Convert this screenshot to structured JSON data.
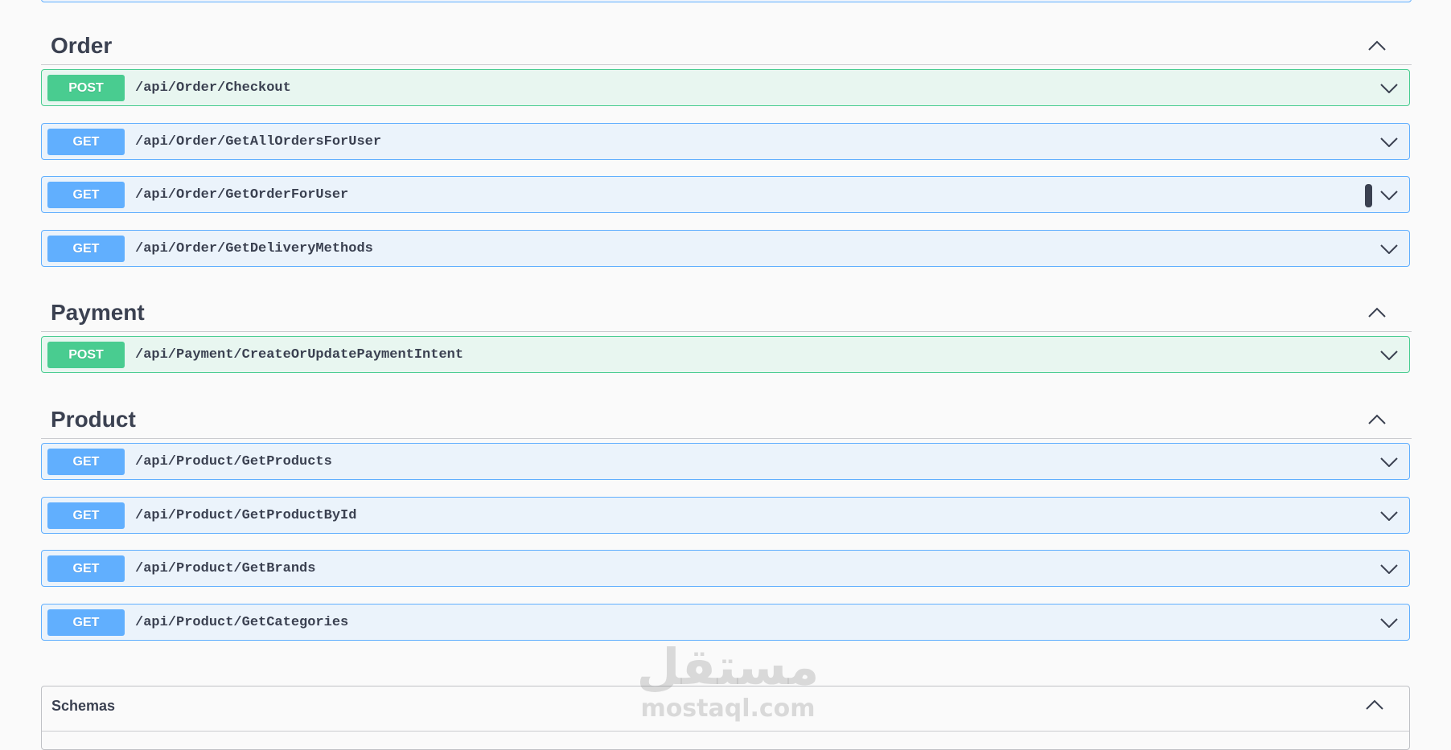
{
  "sections": [
    {
      "title": "Order",
      "operations": [
        {
          "method": "POST",
          "path": "/api/Order/Checkout"
        },
        {
          "method": "GET",
          "path": "/api/Order/GetAllOrdersForUser"
        },
        {
          "method": "GET",
          "path": "/api/Order/GetOrderForUser"
        },
        {
          "method": "GET",
          "path": "/api/Order/GetDeliveryMethods"
        }
      ]
    },
    {
      "title": "Payment",
      "operations": [
        {
          "method": "POST",
          "path": "/api/Payment/CreateOrUpdatePaymentIntent"
        }
      ]
    },
    {
      "title": "Product",
      "operations": [
        {
          "method": "GET",
          "path": "/api/Product/GetProducts"
        },
        {
          "method": "GET",
          "path": "/api/Product/GetProductById"
        },
        {
          "method": "GET",
          "path": "/api/Product/GetBrands"
        },
        {
          "method": "GET",
          "path": "/api/Product/GetCategories"
        }
      ]
    }
  ],
  "schemas": {
    "title": "Schemas"
  },
  "watermark": {
    "arabic": "مستقل",
    "latin": "mostaql.com"
  },
  "colors": {
    "get": "#61affe",
    "post": "#49cc90",
    "text": "#3b4151"
  }
}
